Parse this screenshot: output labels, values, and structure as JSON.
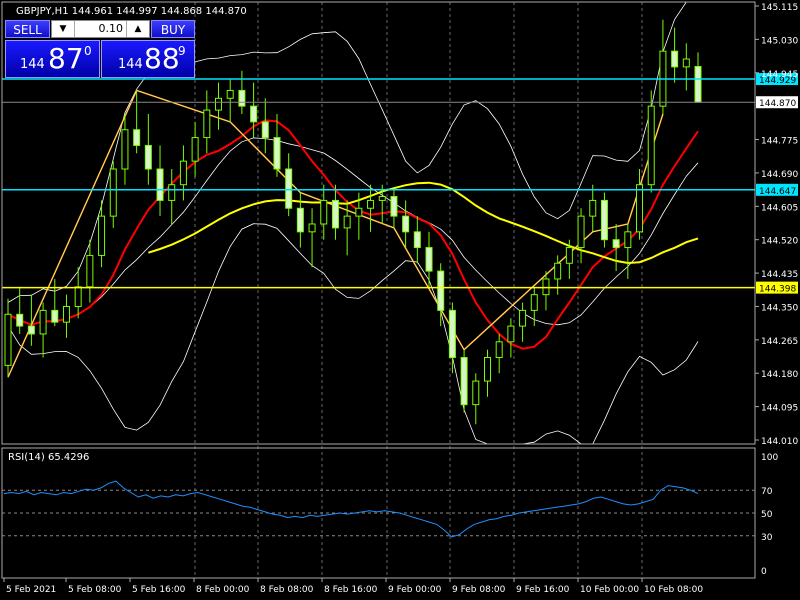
{
  "header": {
    "text": "GBPJPY,H1  144.961 144.997 144.868 144.870"
  },
  "trade_panel": {
    "sell_label": "SELL",
    "buy_label": "BUY",
    "lot": "0.10",
    "sell_price": {
      "small": "144",
      "big": "87",
      "sup": "0"
    },
    "buy_price": {
      "small": "144",
      "big": "88",
      "sup": "9"
    }
  },
  "price_axis": {
    "ticks": [
      "145.115",
      "145.030",
      "144.945",
      "144.775",
      "144.690",
      "144.605",
      "144.520",
      "144.435",
      "144.350",
      "144.265",
      "144.180",
      "144.095",
      "144.010"
    ],
    "ylim": [
      144.01,
      145.115
    ]
  },
  "levels": [
    {
      "price": 144.929,
      "label": "144.929",
      "color": "#00e5ff"
    },
    {
      "price": 144.647,
      "label": "144.647",
      "color": "#00e5ff"
    },
    {
      "price": 144.398,
      "label": "144.398",
      "color": "#ffff00"
    }
  ],
  "current_price": {
    "price": 144.87,
    "label": "144.870"
  },
  "rsi": {
    "label": "RSI(14) 65.4296",
    "ticks": [
      "100",
      "70",
      "50",
      "30",
      "0"
    ],
    "levels": [
      70,
      50,
      30
    ],
    "values": [
      67,
      68,
      67,
      69,
      66,
      68,
      67,
      66,
      68,
      67,
      69,
      71,
      70,
      72,
      76,
      78,
      72,
      68,
      64,
      66,
      63,
      65,
      64,
      66,
      65,
      67,
      68,
      66,
      64,
      62,
      60,
      58,
      56,
      55,
      53,
      51,
      49,
      48,
      46,
      47,
      46,
      48,
      47,
      48,
      49,
      50,
      49,
      50,
      51,
      52,
      51,
      52,
      51,
      50,
      48,
      46,
      44,
      42,
      40,
      35,
      29,
      31,
      36,
      40,
      42,
      44,
      45,
      47,
      48,
      50,
      51,
      52,
      53,
      54,
      55,
      56,
      57,
      58,
      60,
      63,
      64,
      62,
      60,
      58,
      57,
      58,
      60,
      62,
      70,
      74,
      73,
      72,
      70,
      67
    ]
  },
  "time_axis": {
    "labels": [
      "5 Feb 2021",
      "5 Feb 08:00",
      "5 Feb 16:00",
      "8 Feb 00:00",
      "8 Feb 08:00",
      "8 Feb 16:00",
      "9 Feb 00:00",
      "9 Feb 08:00",
      "9 Feb 16:00",
      "10 Feb 00:00",
      "10 Feb 08:00"
    ]
  },
  "colors": {
    "candle": "#7CFC00",
    "ma_fast": "#ff0000",
    "ma_slow": "#ffff00",
    "bands": "#ffffff",
    "zigzag": "#ffa500",
    "rsi_line": "#1e90ff"
  },
  "chart_data": {
    "type": "candlestick",
    "title": "GBPJPY,H1",
    "ylim": [
      144.01,
      145.115
    ],
    "candles": [
      [
        144.2,
        144.37,
        144.17,
        144.33
      ],
      [
        144.33,
        144.4,
        144.28,
        144.3
      ],
      [
        144.3,
        144.38,
        144.25,
        144.28
      ],
      [
        144.28,
        144.36,
        144.22,
        144.34
      ],
      [
        144.34,
        144.42,
        144.3,
        144.31
      ],
      [
        144.31,
        144.38,
        144.27,
        144.35
      ],
      [
        144.35,
        144.45,
        144.32,
        144.4
      ],
      [
        144.4,
        144.52,
        144.36,
        144.48
      ],
      [
        144.48,
        144.62,
        144.45,
        144.58
      ],
      [
        144.58,
        144.72,
        144.55,
        144.7
      ],
      [
        144.7,
        144.84,
        144.66,
        144.8
      ],
      [
        144.8,
        144.9,
        144.74,
        144.76
      ],
      [
        144.76,
        144.84,
        144.66,
        144.7
      ],
      [
        144.7,
        144.76,
        144.58,
        144.62
      ],
      [
        144.62,
        144.7,
        144.56,
        144.66
      ],
      [
        144.66,
        144.76,
        144.62,
        144.72
      ],
      [
        144.72,
        144.82,
        144.68,
        144.78
      ],
      [
        144.78,
        144.9,
        144.74,
        144.85
      ],
      [
        144.85,
        144.92,
        144.8,
        144.88
      ],
      [
        144.88,
        144.93,
        144.82,
        144.9
      ],
      [
        144.9,
        144.95,
        144.84,
        144.86
      ],
      [
        144.86,
        144.92,
        144.78,
        144.82
      ],
      [
        144.82,
        144.88,
        144.74,
        144.78
      ],
      [
        144.78,
        144.84,
        144.68,
        144.7
      ],
      [
        144.7,
        144.74,
        144.58,
        144.6
      ],
      [
        144.6,
        144.64,
        144.5,
        144.54
      ],
      [
        144.54,
        144.6,
        144.45,
        144.56
      ],
      [
        144.56,
        144.66,
        144.52,
        144.62
      ],
      [
        144.62,
        144.66,
        144.52,
        144.55
      ],
      [
        144.55,
        144.62,
        144.48,
        144.58
      ],
      [
        144.58,
        144.64,
        144.52,
        144.6
      ],
      [
        144.6,
        144.66,
        144.54,
        144.62
      ],
      [
        144.62,
        144.66,
        144.56,
        144.63
      ],
      [
        144.63,
        144.65,
        144.55,
        144.58
      ],
      [
        144.58,
        144.62,
        144.5,
        144.54
      ],
      [
        144.54,
        144.58,
        144.46,
        144.5
      ],
      [
        144.5,
        144.54,
        144.4,
        144.44
      ],
      [
        144.44,
        144.46,
        144.3,
        144.34
      ],
      [
        144.34,
        144.36,
        144.18,
        144.22
      ],
      [
        144.22,
        144.24,
        144.08,
        144.1
      ],
      [
        144.1,
        144.18,
        144.05,
        144.16
      ],
      [
        144.16,
        144.24,
        144.12,
        144.22
      ],
      [
        144.22,
        144.28,
        144.18,
        144.26
      ],
      [
        144.26,
        144.32,
        144.22,
        144.3
      ],
      [
        144.3,
        144.36,
        144.26,
        144.34
      ],
      [
        144.34,
        144.4,
        144.3,
        144.38
      ],
      [
        144.38,
        144.44,
        144.34,
        144.42
      ],
      [
        144.42,
        144.48,
        144.38,
        144.46
      ],
      [
        144.46,
        144.52,
        144.42,
        144.5
      ],
      [
        144.5,
        144.6,
        144.46,
        144.58
      ],
      [
        144.58,
        144.66,
        144.54,
        144.62
      ],
      [
        144.62,
        144.64,
        144.5,
        144.52
      ],
      [
        144.52,
        144.56,
        144.44,
        144.5
      ],
      [
        144.5,
        144.56,
        144.42,
        144.54
      ],
      [
        144.54,
        144.7,
        144.52,
        144.66
      ],
      [
        144.66,
        144.9,
        144.64,
        144.86
      ],
      [
        144.86,
        145.08,
        144.84,
        145.0
      ],
      [
        145.0,
        145.06,
        144.92,
        144.96
      ],
      [
        144.96,
        145.02,
        144.9,
        144.98
      ],
      [
        144.961,
        144.997,
        144.868,
        144.87
      ]
    ]
  }
}
